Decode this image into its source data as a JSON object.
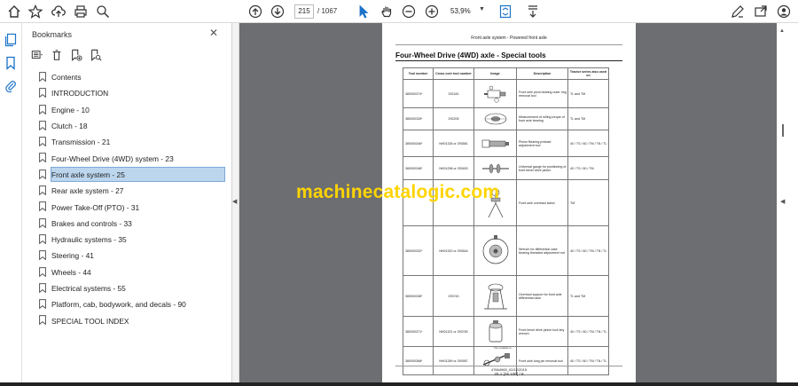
{
  "toolbar": {
    "page_current": "215",
    "page_total": "/ 1067",
    "zoom": "53,9%",
    "icons": [
      "home-icon",
      "star-icon",
      "upload-cloud-icon",
      "print-icon",
      "zoom-search-icon",
      "page-up-icon",
      "page-down-icon",
      "select-cursor-icon",
      "hand-tool-icon",
      "zoom-out-icon",
      "zoom-in-icon",
      "fit-page-icon",
      "scroll-mode-icon",
      "edit-sign-icon",
      "share-email-icon",
      "account-icon"
    ]
  },
  "rail": {
    "icons": [
      "pages-icon",
      "bookmark-icon",
      "attachment-icon"
    ]
  },
  "bookmarks": {
    "title": "Bookmarks",
    "close": "✕",
    "items": [
      {
        "label": "Contents"
      },
      {
        "label": "INTRODUCTION"
      },
      {
        "label": "Engine - 10"
      },
      {
        "label": "Clutch - 18"
      },
      {
        "label": "Transmission - 21"
      },
      {
        "label": "Four-Wheel Drive (4WD) system - 23"
      },
      {
        "label": "Front axle system - 25",
        "selected": true
      },
      {
        "label": "Rear axle system - 27"
      },
      {
        "label": "Power Take-Off (PTO) - 31"
      },
      {
        "label": "Brakes and controls - 33"
      },
      {
        "label": "Hydraulic systems - 35"
      },
      {
        "label": "Steering - 41"
      },
      {
        "label": "Wheels - 44"
      },
      {
        "label": "Electrical systems - 55"
      },
      {
        "label": "Platform, cab, bodywork, and decals - 90"
      },
      {
        "label": "SPECIAL TOOL INDEX"
      }
    ]
  },
  "document": {
    "header": "Front axle system - Powered front axle",
    "title": "Four-Wheel Drive (4WD) axle - Special tools",
    "columns": [
      "Tool number",
      "Cross over tool number",
      "Image",
      "Description",
      "Tractor series also used on"
    ],
    "rows": [
      {
        "part": "380000374*",
        "cross": "292181",
        "desc": "Front axle pivot bearing outer ring removal tool",
        "series": "TL and TM"
      },
      {
        "part": "380000335*",
        "cross": "292205",
        "desc": "Measurement of rolling torque of front axle bearing",
        "series": "TL and TM"
      },
      {
        "part": "380000346*",
        "cross": "NH01326 or 293581",
        "desc": "Pinion Bearing preload adjustment tool",
        "series": "40 / TS / 60 / TM / TN / TL"
      },
      {
        "part": "380000348*",
        "cross": "NH01298 or 293400",
        "desc": "Universal gauge for positioning of front bevel drive pinion",
        "series": "40 / TS / 60 / TM"
      },
      {
        "part": "",
        "cross": "",
        "desc": "Front axle overhaul stand",
        "series": "TM"
      },
      {
        "part": "380000332*",
        "cross": "NH01320 or 293544",
        "desc": "Wrench for differential case bearing threaded adjustment nut",
        "series": "40 / TS / 60 / TM / TN / TL"
      },
      {
        "part": "380000338*",
        "cross": "293743",
        "desc": "Overhaul support for front axle differential case",
        "series": "TL and TM"
      },
      {
        "part": "380000371*",
        "cross": "NH01321 or 293783",
        "desc": "Front bevel drive pinion lock key wrench",
        "series": "40 / TS / 60 / TM / TN / TL"
      },
      {
        "part": "380000368*",
        "cross": "NH01289 or 293957",
        "desc": "Front axle king pin removal tool",
        "series": "40 / TS / 60 / TM / TN / TL"
      }
    ],
    "note": "* Also available at ...",
    "footer1": "47664963_02/12/2015",
    "footer2": "25.1 [25.100] / 8"
  },
  "watermark": "machinecatalogic.com"
}
